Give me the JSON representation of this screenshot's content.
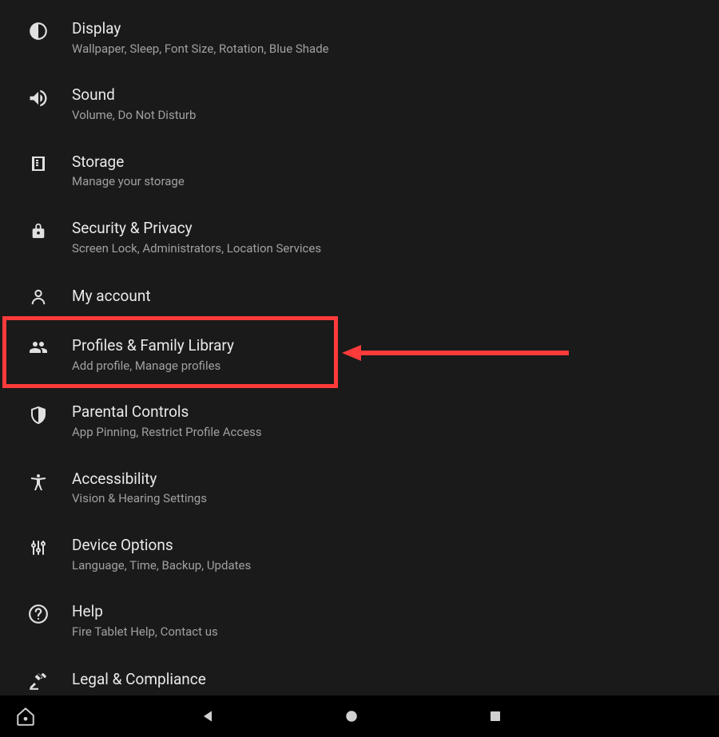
{
  "settings": [
    {
      "key": "display",
      "title": "Display",
      "subtitle": "Wallpaper, Sleep, Font Size, Rotation, Blue Shade",
      "icon": "contrast"
    },
    {
      "key": "sound",
      "title": "Sound",
      "subtitle": "Volume, Do Not Disturb",
      "icon": "sound"
    },
    {
      "key": "storage",
      "title": "Storage",
      "subtitle": "Manage your storage",
      "icon": "storage"
    },
    {
      "key": "security",
      "title": "Security & Privacy",
      "subtitle": "Screen Lock, Administrators, Location Services",
      "icon": "lock"
    },
    {
      "key": "account",
      "title": "My account",
      "subtitle": "",
      "icon": "person"
    },
    {
      "key": "profiles",
      "title": "Profiles & Family Library",
      "subtitle": "Add profile, Manage profiles",
      "icon": "people"
    },
    {
      "key": "parental",
      "title": "Parental Controls",
      "subtitle": "App Pinning, Restrict Profile Access",
      "icon": "shield"
    },
    {
      "key": "accessibility",
      "title": "Accessibility",
      "subtitle": "Vision & Hearing Settings",
      "icon": "accessibility"
    },
    {
      "key": "device",
      "title": "Device Options",
      "subtitle": "Language, Time, Backup, Updates",
      "icon": "sliders"
    },
    {
      "key": "help",
      "title": "Help",
      "subtitle": "Fire Tablet Help, Contact us",
      "icon": "help"
    },
    {
      "key": "legal",
      "title": "Legal & Compliance",
      "subtitle": "",
      "icon": "gavel"
    }
  ],
  "annotation": {
    "highlighted_key": "profiles",
    "color": "#ff3a3a"
  },
  "navbar": {
    "home": "home",
    "back": "back",
    "overview_home": "circle",
    "recent": "square"
  }
}
